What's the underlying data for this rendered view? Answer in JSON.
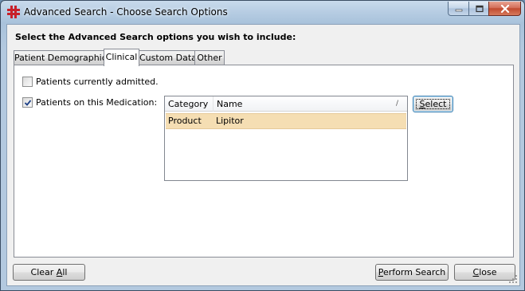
{
  "window": {
    "title": "Advanced Search - Choose Search Options",
    "icon": "red-cross-app-icon"
  },
  "header": {
    "label": "Select the Advanced Search options you wish to include:"
  },
  "tabs": [
    {
      "label": "Patient Demographics",
      "active": false
    },
    {
      "label": "Clinical",
      "active": true
    },
    {
      "label": "Custom Data",
      "active": false
    },
    {
      "label": "Other",
      "active": false
    }
  ],
  "clinical": {
    "admitted": {
      "label": "Patients currently admitted.",
      "checked": false
    },
    "medication": {
      "label": "Patients on this Medication:",
      "checked": true
    },
    "medication_list": {
      "columns": [
        "Category",
        "Name"
      ],
      "rows": [
        {
          "category": "Product",
          "name": "Lipitor",
          "selected": true
        }
      ]
    },
    "select_button": {
      "label": "Select",
      "mnemonic": "S",
      "rest": "elect"
    }
  },
  "footer": {
    "clear_all": {
      "pre": "Clear ",
      "mnemonic": "A",
      "rest": "ll"
    },
    "perform_search": {
      "pre": "",
      "mnemonic": "P",
      "rest": "erform Search"
    },
    "close": {
      "pre": "",
      "mnemonic": "C",
      "rest": "lose"
    }
  },
  "colors": {
    "selected_row": "#f5deb3",
    "title_gradient": "#b7cde3",
    "close_button": "#c14a30"
  }
}
